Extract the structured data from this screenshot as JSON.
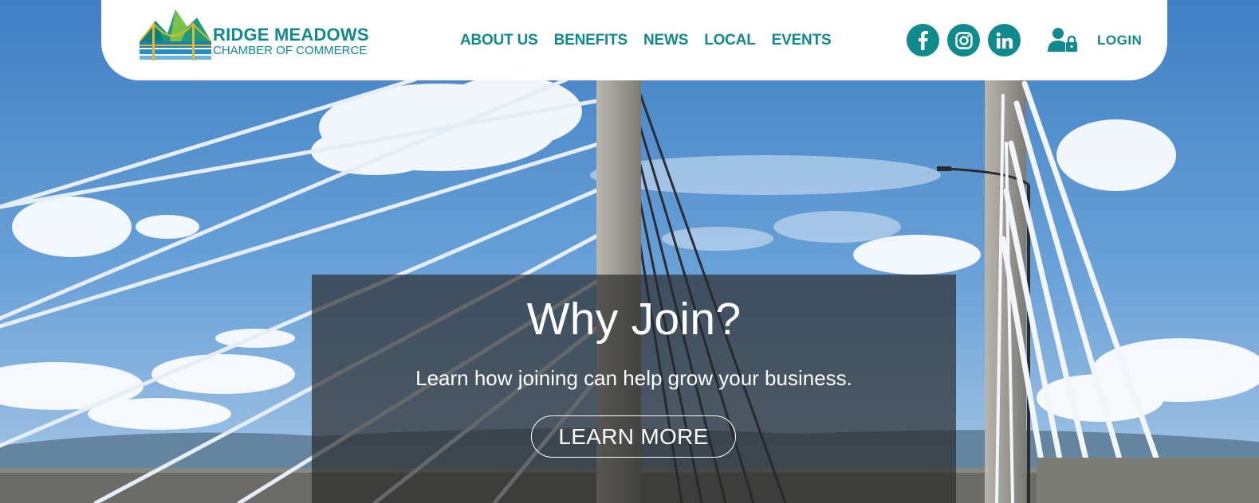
{
  "brand": {
    "name_line1": "RIDGE MEADOWS",
    "name_line2": "CHAMBER OF COMMERCE"
  },
  "nav": {
    "items": [
      "ABOUT US",
      "BENEFITS",
      "NEWS",
      "LOCAL",
      "EVENTS"
    ]
  },
  "social": {
    "icons": [
      "facebook-icon",
      "instagram-icon",
      "linkedin-icon"
    ]
  },
  "account": {
    "login_label": "LOGIN",
    "icon": "user-lock-icon"
  },
  "hero": {
    "title": "Why Join?",
    "subtitle": "Learn how joining can help grow your business.",
    "button_label": "LEARN MORE"
  },
  "colors": {
    "brand_teal": "#0f8a8d",
    "sky": "#4d8cc8",
    "panel_overlay": "rgba(40,40,40,0.68)"
  }
}
